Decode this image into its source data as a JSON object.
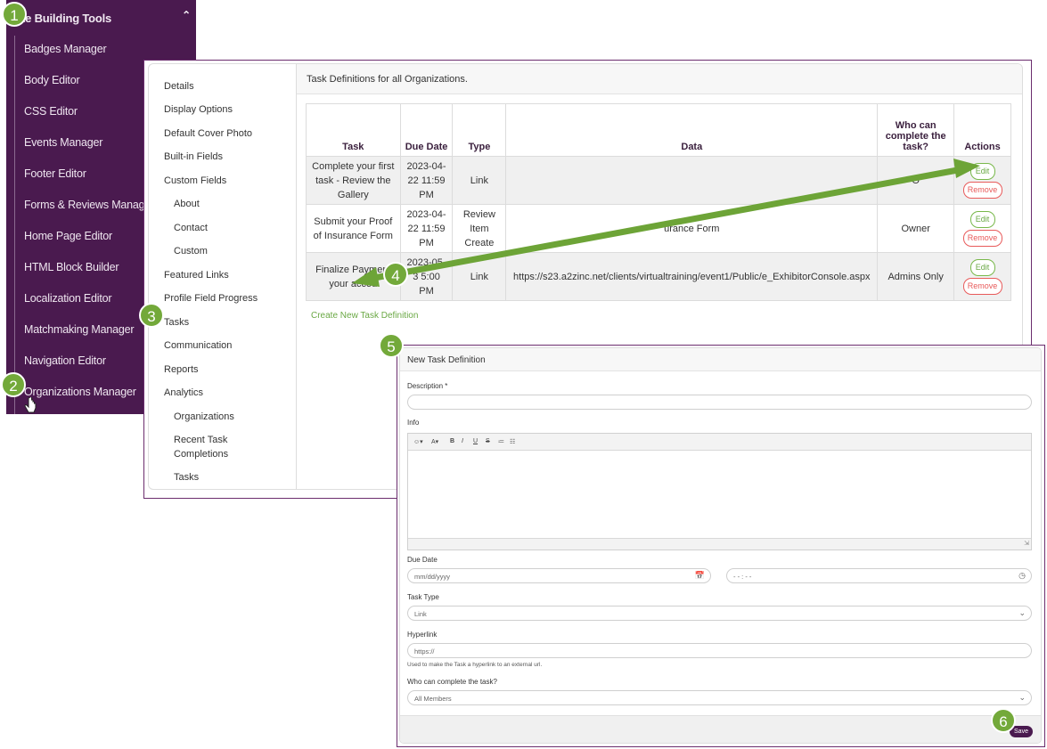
{
  "sidebar": {
    "title": "te Building Tools",
    "items": [
      "Badges Manager",
      "Body Editor",
      "CSS Editor",
      "Events Manager",
      "Footer Editor",
      "Forms & Reviews Manager",
      "Home Page Editor",
      "HTML Block Builder",
      "Localization Editor",
      "Matchmaking Manager",
      "Navigation Editor",
      "Organizations Manager"
    ]
  },
  "leftnav": {
    "items": [
      "Details",
      "Display Options",
      "Default Cover Photo",
      "Built-in Fields",
      "Custom Fields",
      "About",
      "Contact",
      "Custom",
      "Featured Links",
      "Profile Field Progress",
      "Tasks",
      "Communication",
      "Reports",
      "Analytics",
      "Organizations",
      "Recent Task",
      "Completions",
      "Tasks"
    ]
  },
  "main": {
    "heading": "Task Definitions for all Organizations.",
    "columns": [
      "Task",
      "Due Date",
      "Type",
      "Data",
      "Who can complete the task?",
      "Actions"
    ],
    "rows": [
      {
        "task": "Complete your first task - Review the Gallery",
        "due": "2023-04-22 11:59 PM",
        "type": "Link",
        "data": "",
        "who": "O",
        "edit": "Edit",
        "remove": "Remove"
      },
      {
        "task": "Submit your Proof of Insurance Form",
        "due": "2023-04-22 11:59 PM",
        "type": "Review Item Create",
        "data": "urance Form",
        "who": "Owner",
        "edit": "Edit",
        "remove": "Remove"
      },
      {
        "task": "Finalize Payment your accou",
        "due": "2023-05- 3 5:00 PM",
        "type": "Link",
        "data": "https://s23.a2zinc.net/clients/virtualtraining/event1/Public/e_ExhibitorConsole.aspx",
        "who": "Admins Only",
        "edit": "Edit",
        "remove": "Remove"
      }
    ],
    "create_link": "Create New Task Definition"
  },
  "form": {
    "title": "New Task Definition",
    "description_label": "Description *",
    "info_label": "Info",
    "toolbar": [
      "☺▾",
      "A▾",
      "B",
      "I",
      "U",
      "S",
      "≔",
      "☷"
    ],
    "due_date_label": "Due Date",
    "date_placeholder": "mm/dd/yyyy",
    "time_placeholder": "- - : - -",
    "task_type_label": "Task Type",
    "task_type_value": "Link",
    "hyperlink_label": "Hyperlink",
    "hyperlink_placeholder": "https://",
    "hyperlink_hint": "Used to make the Task a hyperlink to an external url.",
    "who_label": "Who can complete the task?",
    "who_value": "All Members",
    "save_label": "Save"
  },
  "steps": [
    "1",
    "2",
    "3",
    "4",
    "5",
    "6"
  ],
  "colors": {
    "sidebar": "#4a1a4f",
    "accent_green": "#73a93a",
    "remove_red": "#e85a5a"
  }
}
